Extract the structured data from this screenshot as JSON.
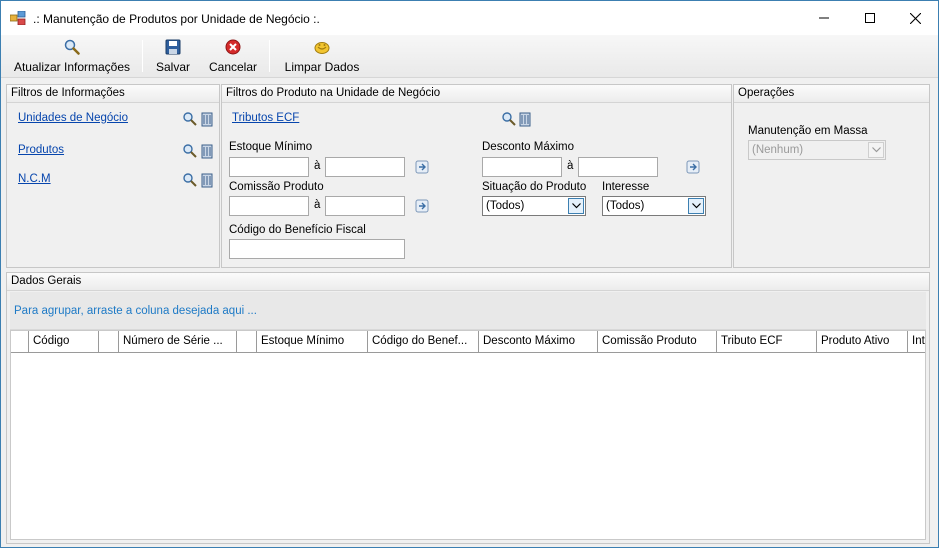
{
  "window": {
    "title": ".: Manutenção de Produtos por Unidade de Negócio :."
  },
  "toolbar": {
    "refresh_label": "Atualizar Informações",
    "save_label": "Salvar",
    "cancel_label": "Cancelar",
    "clear_label": "Limpar Dados"
  },
  "filtros_info": {
    "header": "Filtros de Informações",
    "links": [
      "Unidades de Negócio",
      "Produtos",
      "N.C.M"
    ]
  },
  "filtros_produto": {
    "header": "Filtros do Produto na Unidade de Negócio",
    "tributos_link": "Tributos ECF",
    "estoque_minimo_label": "Estoque Mínimo",
    "desconto_maximo_label": "Desconto Máximo",
    "comissao_label": "Comissão Produto",
    "situacao_label": "Situação do Produto",
    "interesse_label": "Interesse",
    "beneficio_label": "Código do Benefício Fiscal",
    "range_sep": "à",
    "situacao_value": "(Todos)",
    "interesse_value": "(Todos)"
  },
  "operacoes": {
    "header": "Operações",
    "massa_label": "Manutenção em Massa",
    "massa_value": "(Nenhum)"
  },
  "dados_gerais": {
    "header": "Dados Gerais",
    "group_hint": "Para agrupar, arraste a coluna desejada aqui ...",
    "columns": [
      "",
      "Código",
      "",
      "Número de Série ...",
      "",
      "Estoque Mínimo",
      "Código do Benef...",
      "Desconto Máximo",
      "Comissão Produto",
      "Tributo ECF",
      "Produto Ativo",
      "Inte"
    ]
  },
  "colors": {
    "link": "#0645ad",
    "hint": "#1e7ac6",
    "window_border": "#3c7fb1"
  }
}
